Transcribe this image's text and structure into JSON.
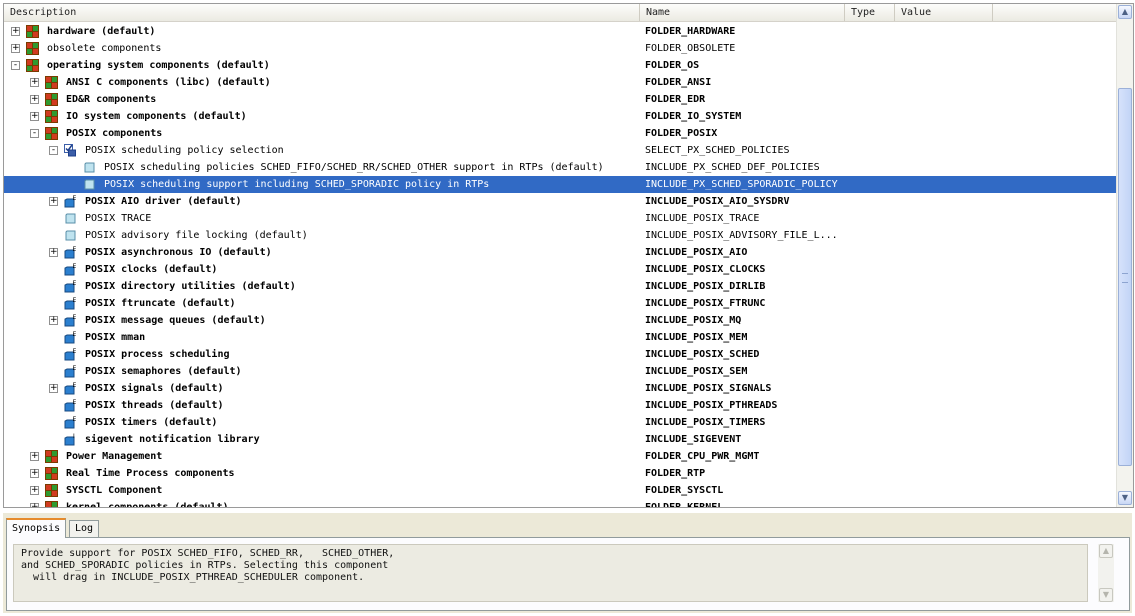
{
  "columns": {
    "description": "Description",
    "name": "Name",
    "type": "Type",
    "value": "Value"
  },
  "rows": [
    {
      "level": 0,
      "expander": "+",
      "icon": "folder",
      "bold": true,
      "desc": "hardware (default)",
      "name": "FOLDER_HARDWARE"
    },
    {
      "level": 0,
      "expander": "+",
      "icon": "folder",
      "bold": false,
      "desc": "obsolete components",
      "name": "FOLDER_OBSOLETE"
    },
    {
      "level": 0,
      "expander": "-",
      "icon": "folder",
      "bold": true,
      "desc": "operating system components (default)",
      "name": "FOLDER_OS"
    },
    {
      "level": 1,
      "expander": "+",
      "icon": "folder",
      "bold": true,
      "desc": "ANSI C components (libc) (default)",
      "name": "FOLDER_ANSI"
    },
    {
      "level": 1,
      "expander": "+",
      "icon": "folder",
      "bold": true,
      "desc": "ED&R components",
      "name": "FOLDER_EDR"
    },
    {
      "level": 1,
      "expander": "+",
      "icon": "folder",
      "bold": true,
      "desc": "IO system components (default)",
      "name": "FOLDER_IO_SYSTEM"
    },
    {
      "level": 1,
      "expander": "-",
      "icon": "folder",
      "bold": true,
      "desc": "POSIX components",
      "name": "FOLDER_POSIX"
    },
    {
      "level": 2,
      "expander": "-",
      "icon": "selection",
      "bold": false,
      "desc": "POSIX scheduling policy selection",
      "name": "SELECT_PX_SCHED_POLICIES"
    },
    {
      "level": 3,
      "expander": "",
      "icon": "comp-plain",
      "bold": false,
      "desc": "POSIX scheduling policies SCHED_FIFO/SCHED_RR/SCHED_OTHER support in RTPs (default)",
      "name": "INCLUDE_PX_SCHED_DEF_POLICIES"
    },
    {
      "level": 3,
      "expander": "",
      "icon": "comp-plain",
      "bold": false,
      "selected": true,
      "desc": "POSIX scheduling support including SCHED_SPORADIC policy in RTPs",
      "name": "INCLUDE_PX_SCHED_SPORADIC_POLICY"
    },
    {
      "level": 2,
      "expander": "+",
      "icon": "comp-e",
      "bold": true,
      "desc": "POSIX AIO driver (default)",
      "name": "INCLUDE_POSIX_AIO_SYSDRV"
    },
    {
      "level": 2,
      "expander": "",
      "icon": "comp-plain",
      "bold": false,
      "desc": "POSIX TRACE",
      "name": "INCLUDE_POSIX_TRACE"
    },
    {
      "level": 2,
      "expander": "",
      "icon": "comp-plain",
      "bold": false,
      "desc": "POSIX advisory file locking (default)",
      "name": "INCLUDE_POSIX_ADVISORY_FILE_L..."
    },
    {
      "level": 2,
      "expander": "+",
      "icon": "comp-e",
      "bold": true,
      "desc": "POSIX asynchronous IO (default)",
      "name": "INCLUDE_POSIX_AIO"
    },
    {
      "level": 2,
      "expander": "",
      "icon": "comp-e",
      "bold": true,
      "desc": "POSIX clocks (default)",
      "name": "INCLUDE_POSIX_CLOCKS"
    },
    {
      "level": 2,
      "expander": "",
      "icon": "comp-e",
      "bold": true,
      "desc": "POSIX directory utilities (default)",
      "name": "INCLUDE_POSIX_DIRLIB"
    },
    {
      "level": 2,
      "expander": "",
      "icon": "comp-e",
      "bold": true,
      "desc": "POSIX ftruncate (default)",
      "name": "INCLUDE_POSIX_FTRUNC"
    },
    {
      "level": 2,
      "expander": "+",
      "icon": "comp-e",
      "bold": true,
      "desc": "POSIX message queues (default)",
      "name": "INCLUDE_POSIX_MQ"
    },
    {
      "level": 2,
      "expander": "",
      "icon": "comp-e",
      "bold": true,
      "desc": "POSIX mman",
      "name": "INCLUDE_POSIX_MEM"
    },
    {
      "level": 2,
      "expander": "",
      "icon": "comp-e",
      "bold": true,
      "desc": "POSIX process scheduling",
      "name": "INCLUDE_POSIX_SCHED"
    },
    {
      "level": 2,
      "expander": "",
      "icon": "comp-e",
      "bold": true,
      "desc": "POSIX semaphores (default)",
      "name": "INCLUDE_POSIX_SEM"
    },
    {
      "level": 2,
      "expander": "+",
      "icon": "comp-e",
      "bold": true,
      "desc": "POSIX signals (default)",
      "name": "INCLUDE_POSIX_SIGNALS"
    },
    {
      "level": 2,
      "expander": "",
      "icon": "comp-e",
      "bold": true,
      "desc": "POSIX threads (default)",
      "name": "INCLUDE_POSIX_PTHREADS"
    },
    {
      "level": 2,
      "expander": "",
      "icon": "comp-e",
      "bold": true,
      "desc": "POSIX timers (default)",
      "name": "INCLUDE_POSIX_TIMERS"
    },
    {
      "level": 2,
      "expander": "",
      "icon": "comp-i",
      "bold": true,
      "desc": "sigevent notification library",
      "name": "INCLUDE_SIGEVENT"
    },
    {
      "level": 1,
      "expander": "+",
      "icon": "folder",
      "bold": true,
      "desc": "Power Management",
      "name": "FOLDER_CPU_PWR_MGMT"
    },
    {
      "level": 1,
      "expander": "+",
      "icon": "folder",
      "bold": true,
      "desc": "Real Time Process components",
      "name": "FOLDER_RTP"
    },
    {
      "level": 1,
      "expander": "+",
      "icon": "folder",
      "bold": true,
      "desc": "SYSCTL Component",
      "name": "FOLDER_SYSCTL"
    },
    {
      "level": 1,
      "expander": "+",
      "icon": "folder",
      "bold": true,
      "desc": "kernel components (default)",
      "name": "FOLDER_KERNEL"
    }
  ],
  "scrollbar": {
    "up_arrow": "▲",
    "down_arrow": "▼"
  },
  "tabs": {
    "synopsis": "Synopsis",
    "log": "Log"
  },
  "synopsis_text": "Provide support for POSIX SCHED_FIFO, SCHED_RR,   SCHED_OTHER,\nand SCHED_SPORADIC policies in RTPs. Selecting this component\n  will drag in INCLUDE_POSIX_PTHREAD_SCHEDULER component.",
  "colors": {
    "selection": "#316ac5",
    "panel": "#ece9d8",
    "tab_accent": "#e68b2c"
  }
}
